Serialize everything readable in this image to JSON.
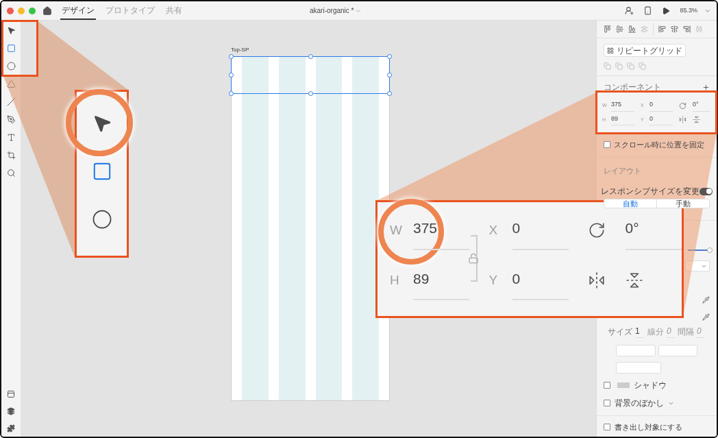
{
  "window": {
    "title": "akari-organic *"
  },
  "mode_tabs": [
    {
      "label": "デザイン",
      "selected": true
    },
    {
      "label": "プロトタイプ",
      "selected": false
    },
    {
      "label": "共有",
      "selected": false
    }
  ],
  "zoom": "85.3%",
  "tools": [
    {
      "kind": "select",
      "selected": false
    },
    {
      "kind": "rectangle",
      "selected": true
    },
    {
      "kind": "ellipse",
      "selected": false
    },
    {
      "kind": "polygon",
      "selected": false
    },
    {
      "kind": "line",
      "selected": false
    },
    {
      "kind": "pen",
      "selected": false
    },
    {
      "kind": "text",
      "selected": false
    },
    {
      "kind": "artboard",
      "selected": false
    },
    {
      "kind": "zoom",
      "selected": false
    }
  ],
  "artboard": {
    "title": "Top-SP"
  },
  "panel": {
    "repeat_grid": "リピートグリッド",
    "component_heading": "コンポーネント",
    "transform": {
      "width": {
        "label": "W",
        "value": "375"
      },
      "x": {
        "label": "X",
        "value": "0"
      },
      "height": {
        "label": "H",
        "value": "89"
      },
      "y": {
        "label": "Y",
        "value": "0"
      },
      "rotation": "0°"
    },
    "fix_position": {
      "label": "スクロール時に位置を固定",
      "checked": false
    },
    "layout_heading": "レイアウト",
    "responsive": {
      "label": "レスポンシブサイズを変更",
      "on": true
    },
    "resize_modes": [
      {
        "label": "自動",
        "selected": true
      },
      {
        "label": "手動",
        "selected": false
      }
    ],
    "opacity": {
      "level": 1
    },
    "stroke": {
      "size_label": "サイズ",
      "size": "1",
      "dash_label": "線分",
      "dash": "0",
      "gap_label": "間隔",
      "gap": "0"
    },
    "effects": [
      {
        "label": "シャドウ",
        "checked": false,
        "kind": "shadow"
      },
      {
        "label": "背景のぼかし",
        "checked": false,
        "kind": "blur"
      }
    ],
    "export": {
      "label": "書き出し対象にする",
      "checked": false
    }
  },
  "tools_callout": {
    "tools": [
      {
        "kind": "select",
        "selected": false
      },
      {
        "kind": "rectangle",
        "selected": true
      },
      {
        "kind": "ellipse",
        "selected": false
      }
    ]
  },
  "transform_callout": {
    "width": {
      "label": "W",
      "value": "375"
    },
    "x": {
      "label": "X",
      "value": "0"
    },
    "height": {
      "label": "H",
      "value": "89"
    },
    "y": {
      "label": "Y",
      "value": "0"
    },
    "rotation": "0°"
  }
}
